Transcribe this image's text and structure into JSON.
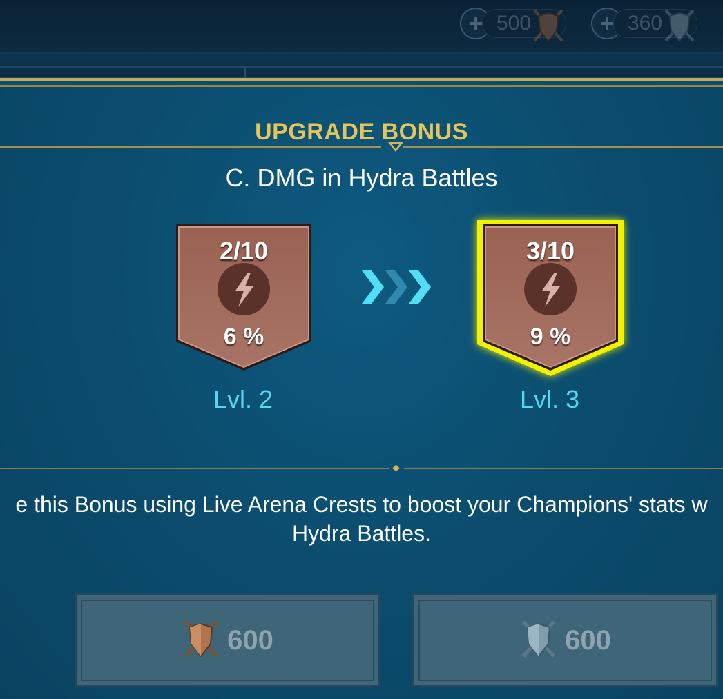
{
  "topbar": {
    "resources": [
      {
        "add_icon": "plus-icon",
        "value": "500",
        "icon": "bronze-arena-crest-icon"
      },
      {
        "add_icon": "plus-icon",
        "value": "360",
        "icon": "silver-arena-crest-icon"
      }
    ]
  },
  "bonus": {
    "heading": "UPGRADE BONUS",
    "stat_name": "C. DMG in Hydra Battles",
    "current": {
      "progress": "2/10",
      "value": "6 %",
      "level": "Lvl. 2",
      "icon": "lightning-icon"
    },
    "next": {
      "progress": "3/10",
      "value": "9 %",
      "level": "Lvl. 3",
      "icon": "lightning-icon"
    },
    "arrow_icon": "triple-chevron-right-icon",
    "description_line1": "e this Bonus using Live Arena Crests to boost your Champions' stats w",
    "description_line2": "Hydra Battles."
  },
  "buttons": [
    {
      "cost": "600",
      "icon": "bronze-arena-crest-icon"
    },
    {
      "cost": "600",
      "icon": "silver-arena-crest-icon"
    }
  ],
  "colors": {
    "background": "#0b4d6e",
    "gold": "#e5c45a",
    "badge": "#9a6a5d",
    "highlight": "#f4f400",
    "level_text": "#55d8f2",
    "arrow_bright": "#53def7",
    "arrow_dim": "#2f8ab0"
  }
}
